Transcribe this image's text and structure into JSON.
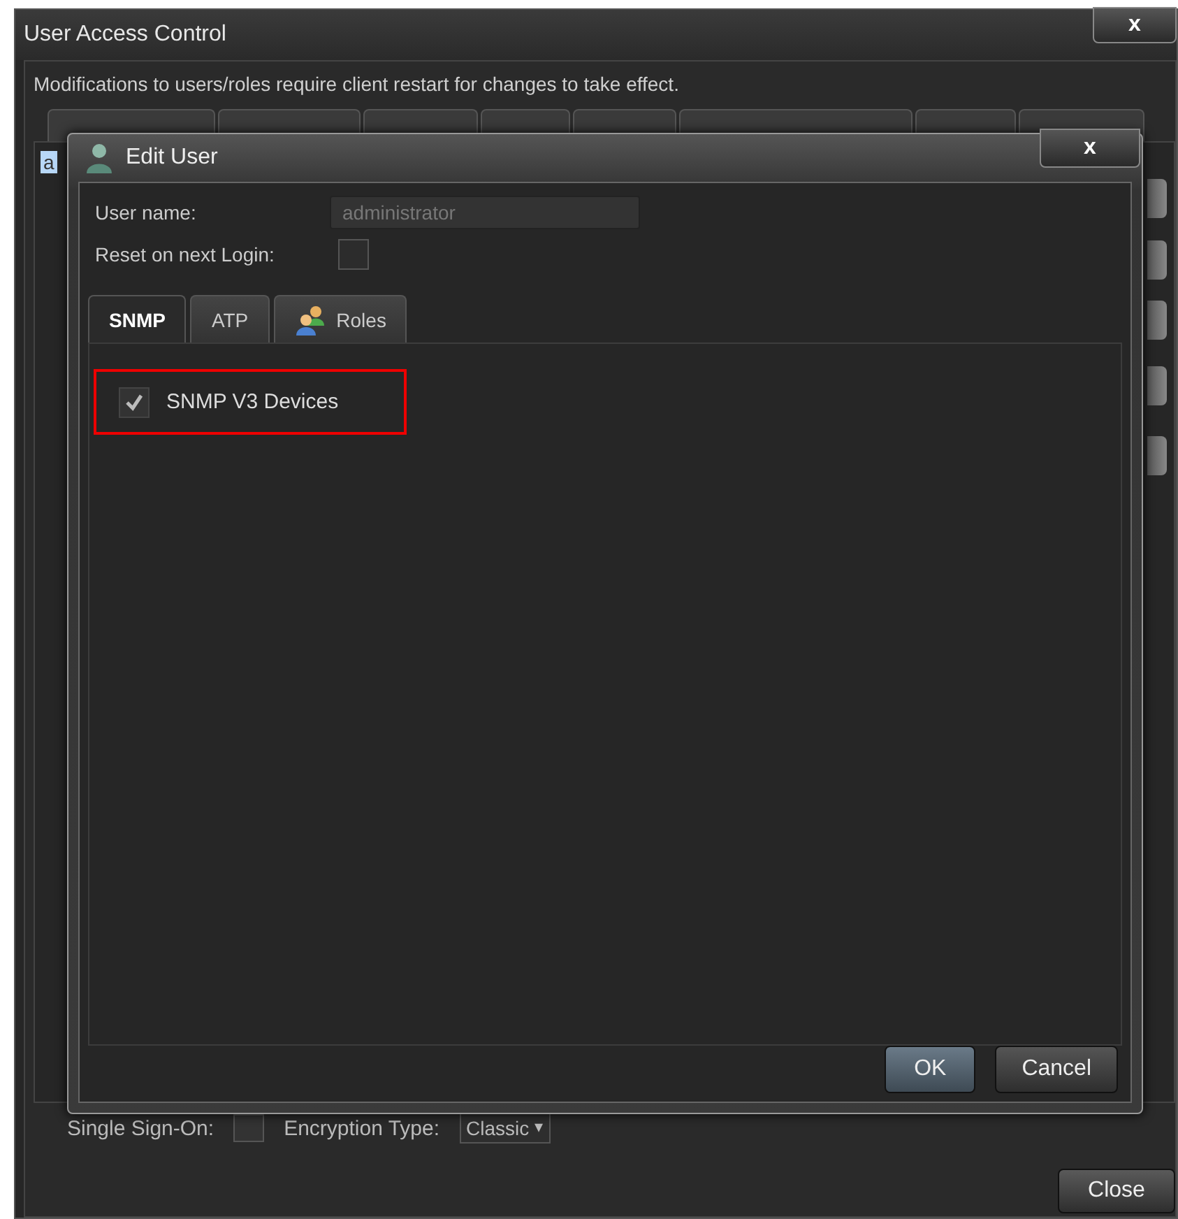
{
  "window": {
    "title": "User Access Control",
    "close": "x",
    "notice": "Modifications to users/roles require client restart for changes to take effect.",
    "user_list": [
      "a"
    ],
    "footer": {
      "single_sign_on_label": "Single Sign-On:",
      "encryption_label": "Encryption Type:",
      "encryption_value": "Classic",
      "dropdown_arrow": "▾",
      "single_sign_on_checked": false
    },
    "buttons": [
      "Close"
    ]
  },
  "dialog": {
    "title": "Edit User",
    "close": "x",
    "user_name_label": "User name:",
    "user_name_value": "administrator",
    "reset_label": "Reset on next Login:",
    "reset_checked": false,
    "tabs": [
      {
        "label": "SNMP",
        "selected": true,
        "kind": "text"
      },
      {
        "label": "ATP",
        "selected": false,
        "kind": "text"
      },
      {
        "label": "Roles",
        "selected": false,
        "kind": "icon"
      }
    ],
    "options": [
      {
        "label": "SNMP V3 Devices",
        "checked": true,
        "highlighted": true
      }
    ],
    "buttons": [
      {
        "label": "OK",
        "kind": "primary"
      },
      {
        "label": "Cancel",
        "kind": "secondary"
      }
    ]
  }
}
